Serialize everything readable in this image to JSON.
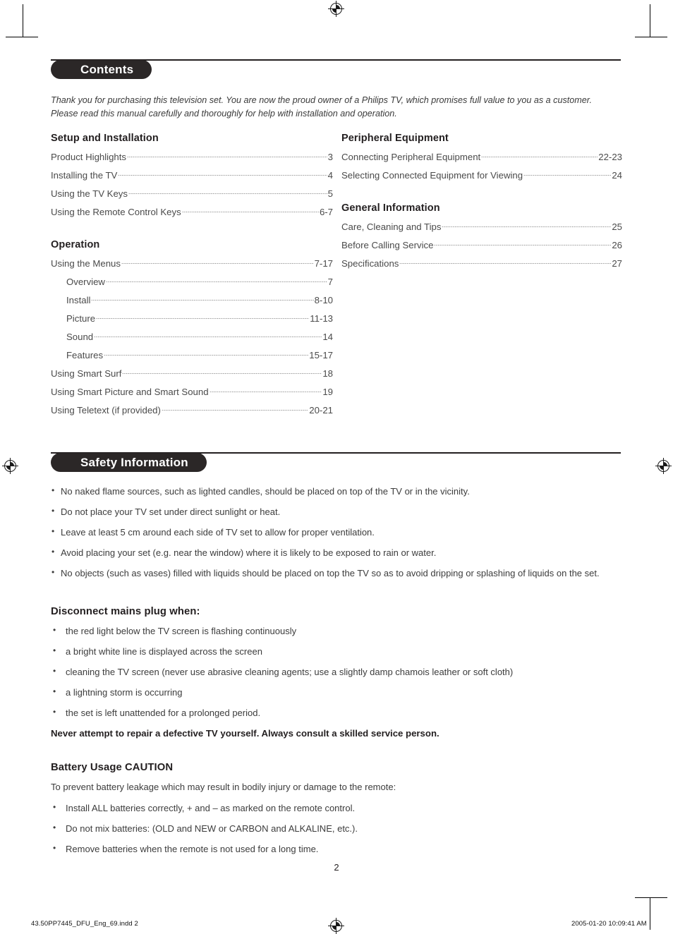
{
  "document": {
    "page_number": "2"
  },
  "contents": {
    "heading": "Contents",
    "intro_line1": "Thank you for purchasing this television set. You are now the proud owner of a Philips TV, which promises full value to you as a customer.",
    "intro_line2": "Please read this manual carefully and thoroughly for help with installation and operation.",
    "left_groups": [
      {
        "title": "Setup and Installation",
        "entries": [
          {
            "label": "Product Highlights",
            "page": "3",
            "level": 0
          },
          {
            "label": "Installing the TV",
            "page": "4",
            "level": 0
          },
          {
            "label": "Using the TV Keys",
            "page": "5",
            "level": 0
          },
          {
            "label": "Using the Remote Control Keys",
            "page": "6-7",
            "level": 0
          }
        ]
      },
      {
        "title": "Operation",
        "entries": [
          {
            "label": "Using the Menus",
            "page": "7-17",
            "level": 0
          },
          {
            "label": "Overview",
            "page": "7",
            "level": 1
          },
          {
            "label": "Install",
            "page": "8-10",
            "level": 1
          },
          {
            "label": "Picture",
            "page": "11-13",
            "level": 1
          },
          {
            "label": "Sound",
            "page": "14",
            "level": 1
          },
          {
            "label": "Features",
            "page": "15-17",
            "level": 1
          },
          {
            "label": "Using Smart Surf",
            "page": "18",
            "level": 0
          },
          {
            "label": "Using Smart Picture and Smart Sound",
            "page": "19",
            "level": 0
          },
          {
            "label": "Using Teletext (if provided)",
            "page": "20-21",
            "level": 0
          }
        ]
      }
    ],
    "right_groups": [
      {
        "title": "Peripheral Equipment",
        "entries": [
          {
            "label": "Connecting Peripheral Equipment",
            "page": "22-23",
            "level": 0
          },
          {
            "label": "Selecting Connected Equipment for Viewing",
            "page": "24",
            "level": 0
          }
        ]
      },
      {
        "title": "General Information",
        "entries": [
          {
            "label": "Care, Cleaning and Tips",
            "page": "25",
            "level": 0
          },
          {
            "label": "Before Calling Service",
            "page": "26",
            "level": 0
          },
          {
            "label": "Specifications",
            "page": "27",
            "level": 0
          }
        ]
      }
    ]
  },
  "safety": {
    "heading": "Safety Information",
    "bullets": [
      "No naked flame sources, such as lighted candles, should be placed on top of the TV or in the vicinity.",
      "Do not place your TV set under direct sunlight or heat.",
      "Leave at least 5 cm around each side of TV set to allow for proper ventilation.",
      "Avoid placing your set (e.g. near the window) where it is likely to be exposed to rain or water.",
      "No objects (such as vases) filled with liquids should be placed on top the TV so as to avoid dripping or splashing of liquids on the set."
    ],
    "disconnect": {
      "heading": "Disconnect mains plug when:",
      "bullets": [
        "the red light below the TV screen is flashing continuously",
        "a bright white line is displayed across the screen",
        "cleaning the TV screen (never use abrasive cleaning agents; use a slightly damp chamois leather or soft cloth)",
        "a lightning storm is occurring",
        "the set is left unattended for a prolonged period."
      ],
      "note": "Never attempt to repair a defective TV yourself. Always consult a skilled service person."
    },
    "battery": {
      "heading": "Battery Usage CAUTION",
      "intro": "To prevent battery leakage which may result in bodily injury or damage to the remote:",
      "bullets": [
        "Install ALL batteries correctly, + and – as marked on the remote control.",
        "Do not mix batteries: (OLD and NEW or CARBON and ALKALINE, etc.).",
        "Remove batteries when the remote is not used for a long time."
      ]
    }
  },
  "print_footer": {
    "file_name": "43.50PP7445_DFU_Eng_69.indd   2",
    "timestamp": "2005-01-20   10:09:41 AM"
  }
}
